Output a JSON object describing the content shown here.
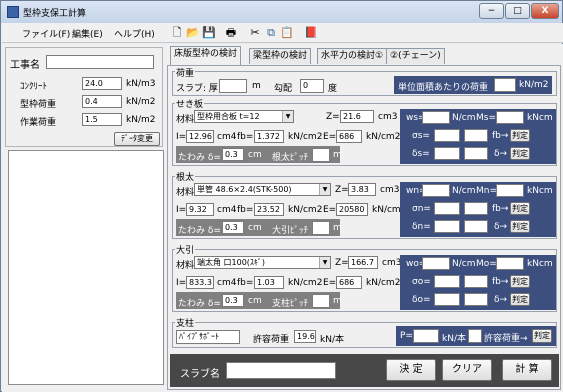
{
  "window": {
    "title": "型枠支保工計算",
    "buttons": {
      "minimize": "−",
      "maximize": "□",
      "close": "X"
    }
  },
  "menu": [
    "ファイル(F)",
    "編集(E)",
    "ヘルプ(H)"
  ],
  "toolbar_icons": [
    "new-file-icon",
    "open-folder-icon",
    "save-icon",
    "print-icon",
    "cut-icon",
    "copy-icon",
    "paste-icon",
    "book-icon"
  ],
  "left": {
    "job_label": "工事名",
    "job_value": "",
    "rows": [
      {
        "label": "ｺﾝｸﾘｰﾄ",
        "value": "24.0",
        "unit": "kN/m3"
      },
      {
        "label": "型枠荷重",
        "value": "0.4",
        "unit": "kN/m2"
      },
      {
        "label": "作業荷重",
        "value": "1.5",
        "unit": "kN/m2"
      }
    ],
    "change_button": "ﾃﾞｰﾀ変更"
  },
  "tabs": [
    "床版型枠の検討",
    "梁型枠の検討",
    "水平力の検討①",
    "②(チェーン)"
  ],
  "load": {
    "title": "荷重",
    "slab_label": "スラブ: 厚",
    "slab_value": "",
    "unit_m": "m",
    "slope_label": "勾配",
    "slope_value": "0",
    "degree": "度",
    "unit_load_label": "単位面積あたりの荷重",
    "unit_load_value": "",
    "unit_load_unit": "kN/m2"
  },
  "sections": [
    {
      "title": "せき板",
      "material_label": "材料",
      "material": "型枠用合板 t=12",
      "z_label": "Z=",
      "z_value": "21.6",
      "z_unit": "cm3",
      "i_label": "I=",
      "i_value": "12.96",
      "i_unit": "cm4",
      "f_label": "fb=",
      "f_value": "1.372",
      "f_unit": "kN/cm2",
      "e_label": "E=",
      "e_value": "686",
      "e_unit": "kN/cm2",
      "defl_label": "たわみ δ=",
      "defl_value": "0.3",
      "defl_unit": "cm",
      "pitch_label": "根太ﾋﾟｯﾁ",
      "pitch_value": "",
      "pitch_unit": "m",
      "w_label": "ws=",
      "w_unit": "N/cm",
      "m_label": "Ms=",
      "m_unit": "kNcm",
      "sigma_label": "σs=",
      "fb_arrow": "fb→",
      "judge": "判定",
      "delta_label": "δs=",
      "delta_arrow": "δ→"
    },
    {
      "title": "根太",
      "material_label": "材料",
      "material": "単管 48.6×2.4(STK-500)",
      "z_label": "Z=",
      "z_value": "3.83",
      "z_unit": "cm3",
      "i_label": "I=",
      "i_value": "9.32",
      "i_unit": "cm4",
      "f_label": "fb=",
      "f_value": "23.52",
      "f_unit": "kN/cm2",
      "e_label": "E=",
      "e_value": "20580",
      "e_unit": "kN/cm2",
      "defl_label": "たわみ δ=",
      "defl_value": "0.3",
      "defl_unit": "cm",
      "pitch_label": "大引ﾋﾟｯﾁ",
      "pitch_value": "",
      "pitch_unit": "m",
      "w_label": "wn=",
      "w_unit": "N/cm",
      "m_label": "Mn=",
      "m_unit": "kNcm",
      "sigma_label": "σn=",
      "fb_arrow": "fb→",
      "judge": "判定",
      "delta_label": "δn=",
      "delta_arrow": "δ→"
    },
    {
      "title": "大引",
      "material_label": "材料",
      "material": "端太角 口100(ｽｷﾞ)",
      "z_label": "Z=",
      "z_value": "166.7",
      "z_unit": "cm3",
      "i_label": "I=",
      "i_value": "833.3",
      "i_unit": "cm4",
      "f_label": "fb=",
      "f_value": "1.03",
      "f_unit": "kN/cm2",
      "e_label": "E=",
      "e_value": "686",
      "e_unit": "kN/cm2",
      "defl_label": "たわみ δ=",
      "defl_value": "0.3",
      "defl_unit": "cm",
      "pitch_label": "支柱ﾋﾟｯﾁ",
      "pitch_value": "",
      "pitch_unit": "m",
      "w_label": "wo=",
      "w_unit": "N/cm",
      "m_label": "Mo=",
      "m_unit": "kNcm",
      "sigma_label": "σo=",
      "fb_arrow": "fb→",
      "judge": "判定",
      "delta_label": "δo=",
      "delta_arrow": "δ→"
    }
  ],
  "support": {
    "title": "支柱",
    "type": "ﾊﾟｲﾌﾟｻﾎﾟｰﾄ",
    "allow_label": "許容荷重",
    "allow_value": "19.6",
    "allow_unit": "kN/本",
    "p_label": "P=",
    "p_unit": "kN/本",
    "allow_arrow_label": "許容荷重→",
    "judge": "判定"
  },
  "bottom": {
    "slab_name_label": "スラブ名",
    "slab_name_value": "",
    "decide": "決 定",
    "clear": "クリア",
    "calc": "計 算"
  }
}
